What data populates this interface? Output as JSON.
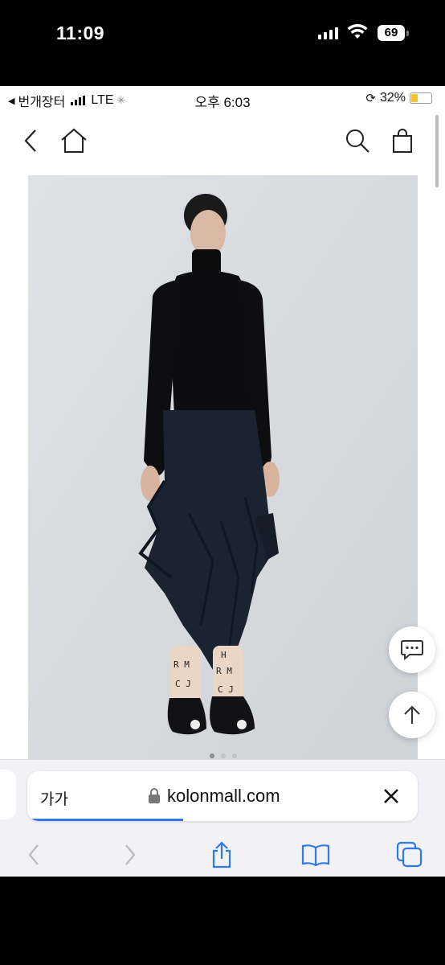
{
  "outer_status": {
    "time": "11:09",
    "battery": "69"
  },
  "inner_status": {
    "carrier": "번개장터",
    "network": "LTE",
    "time": "오후 6:03",
    "battery": "32%"
  },
  "nav": {
    "icons": [
      "chevron-left-icon",
      "home-icon",
      "search-icon",
      "shopping-bag-icon"
    ]
  },
  "product_image": {
    "carousel_active_index": 0
  },
  "floating": {
    "icons": [
      "chat-icon",
      "arrow-up-icon"
    ]
  },
  "safari": {
    "text_size_label": "가가",
    "url": "kolonmall.com",
    "load_progress": 0.4,
    "accent_color": "#2f7ae5"
  },
  "toolbar": {
    "icons": [
      "back-icon",
      "forward-icon",
      "share-icon",
      "bookmarks-icon",
      "tabs-icon"
    ]
  }
}
